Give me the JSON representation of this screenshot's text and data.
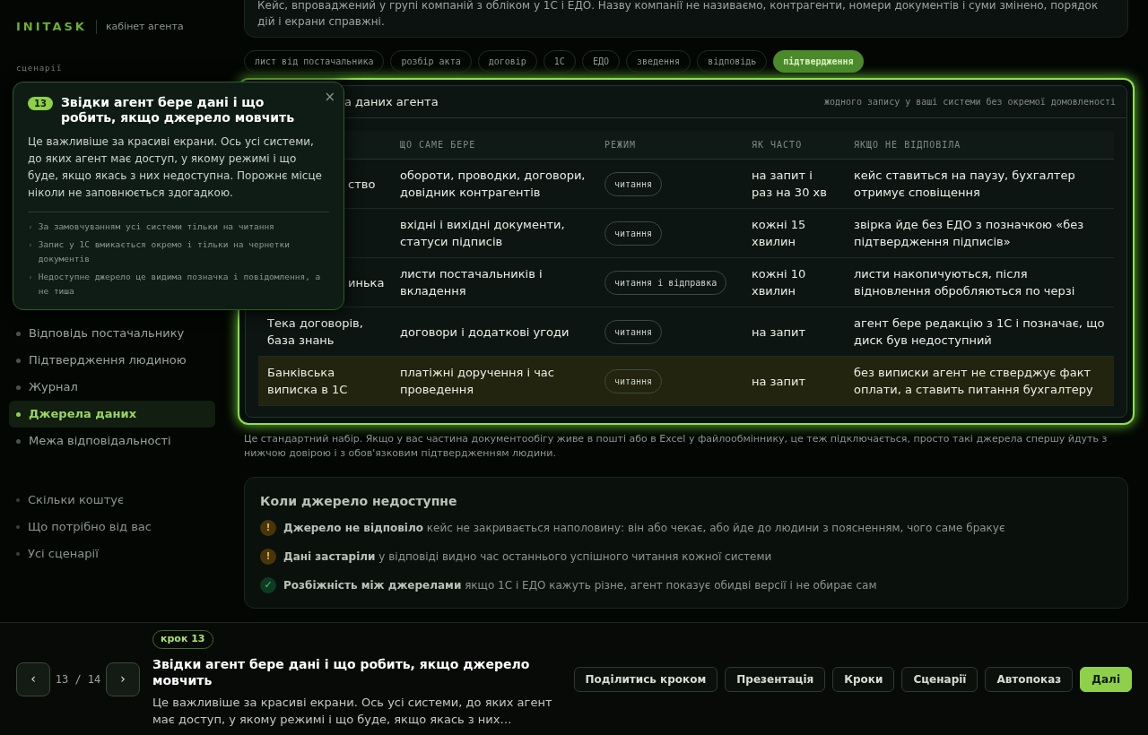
{
  "brand": {
    "logo": "INITASK",
    "subtitle": "кабінет агента"
  },
  "sidebar": {
    "section_label": "сценарії",
    "items": [
      {
        "label": "Відповідь постачальнику",
        "selected": false
      },
      {
        "label": "Підтвердження людиною",
        "selected": false
      },
      {
        "label": "Журнал",
        "selected": false
      },
      {
        "label": "Джерела даних",
        "selected": true
      },
      {
        "label": "Межа відповідальності",
        "selected": false
      }
    ],
    "more_items": [
      {
        "label": "Скільки коштує"
      },
      {
        "label": "Що потрібно від вас"
      },
      {
        "label": "Усі сценарії"
      }
    ]
  },
  "intro": "Кейс, впроваджений у групі компаній з обліком у 1С і ЕДО. Назву компанії не називаємо, контрагенти, номери документів і суми змінено, порядок дій і екрани справжні.",
  "tabs": [
    {
      "label": "лист від постачальника",
      "selected": false
    },
    {
      "label": "розбір акта",
      "selected": false
    },
    {
      "label": "договір",
      "selected": false
    },
    {
      "label": "1С",
      "selected": false
    },
    {
      "label": "ЕДО",
      "selected": false
    },
    {
      "label": "зведення",
      "selected": false
    },
    {
      "label": "відповідь",
      "selected": false
    },
    {
      "label": "підтвердження",
      "selected": true
    }
  ],
  "sources": {
    "title": "а даних агента",
    "note": "жодного запису у ваші системи без окремої домовленості",
    "columns": [
      "ЩО САМЕ БЕРЕ",
      "РЕЖИМ",
      "ЯК ЧАСТО",
      "ЯКЩО НЕ ВІДПОВІЛА"
    ],
    "rows": [
      {
        "system": "ство",
        "data": "обороти, проводки, договори, довідник контрагентів",
        "mode": "читання",
        "frequency": "на запит і раз на 30 хв",
        "fallback": "кейс ставиться на паузу, бухгалтер отримує сповіщення",
        "highlighted": false
      },
      {
        "data": "вхідні і вихідні документи, статуси підписів",
        "mode": "читання",
        "frequency": "кожні 15 хвилин",
        "fallback": "звірка йде без ЕДО з позначкою «без підтвердження підписів»",
        "highlighted": false
      },
      {
        "system": "инька",
        "data": "листи постачальників і вкладення",
        "mode": "читання і відправка",
        "frequency": "кожні 10 хвилин",
        "fallback": "листи накопичуються, після відновлення обробляються по черзі",
        "highlighted": false
      },
      {
        "system": "Тека договорів, база знань",
        "data": "договори і додаткові угоди",
        "mode": "читання",
        "frequency": "на запит",
        "fallback": "агент бере редакцію з 1С і позначає, що диск був недоступний",
        "highlighted": false
      },
      {
        "system": "Банківська виписка в 1С",
        "data": "платіжні доручення і час проведення",
        "mode": "читання",
        "frequency": "на запит",
        "fallback": "без виписки агент не стверджує факт оплати, а ставить питання бухгалтеру",
        "highlighted": true
      }
    ]
  },
  "footnote": "Це стандартний набір. Якщо у вас частина документообігу живе в пошті або в Excel у файлообміннику, це теж підключається, просто такі джерела спершу йдуть з нижчою довірою і з обов'язковим підтвердженням людини.",
  "unavailable": {
    "title": "Коли джерело недоступне",
    "items": [
      {
        "kind": "warning",
        "icon": "!",
        "title": "Джерело не відповіло",
        "text": "кейс не закривається наполовину: він або чекає, або йде до людини з поясненням, чого саме бракує"
      },
      {
        "kind": "warning",
        "icon": "!",
        "title": "Дані застаріли",
        "text": "у відповіді видно час останнього успішного читання кожної системи"
      },
      {
        "kind": "ok",
        "icon": "✓",
        "title": "Розбіжність між джерелами",
        "text": "якщо 1С і ЕДО кажуть різне, агент показує обидві версії і не обирає сам"
      }
    ]
  },
  "popover": {
    "number": "13",
    "title": "Звідки агент бере дані і що робить, якщо джерело мовчить",
    "close": "×",
    "body": "Це важливіше за красиві екрани. Ось усі системи, до яких агент має доступ, у якому режимі і що буде, якщо якась з них недоступна. Порожнє місце ніколи не заповнюється здогадкою.",
    "bullet_marker": "›",
    "bullets": [
      "За замовчуванням усі системи тільки на читання",
      "Запис у 1С вмикається окремо і тільки на чернетки документів",
      "Недоступне джерело це видима позначка і повідомлення, а не тиша"
    ]
  },
  "tour_bar": {
    "prev": "‹",
    "next": "›",
    "counter": "13 / 14",
    "step_badge": "крок 13",
    "title": "Звідки агент бере дані і що робить, якщо джерело мовчить",
    "text": "Це важливіше за красиві екрани. Ось усі системи, до яких агент має доступ, у якому режимі і що буде, якщо якась з них…",
    "buttons": [
      {
        "label": "Поділитись кроком",
        "kind": "secondary"
      },
      {
        "label": "Презентація",
        "kind": "secondary"
      },
      {
        "label": "Кроки",
        "kind": "secondary"
      },
      {
        "label": "Сценарії",
        "kind": "secondary"
      },
      {
        "label": "Автопоказ",
        "kind": "secondary"
      },
      {
        "label": "Далі",
        "kind": "primary"
      }
    ]
  }
}
